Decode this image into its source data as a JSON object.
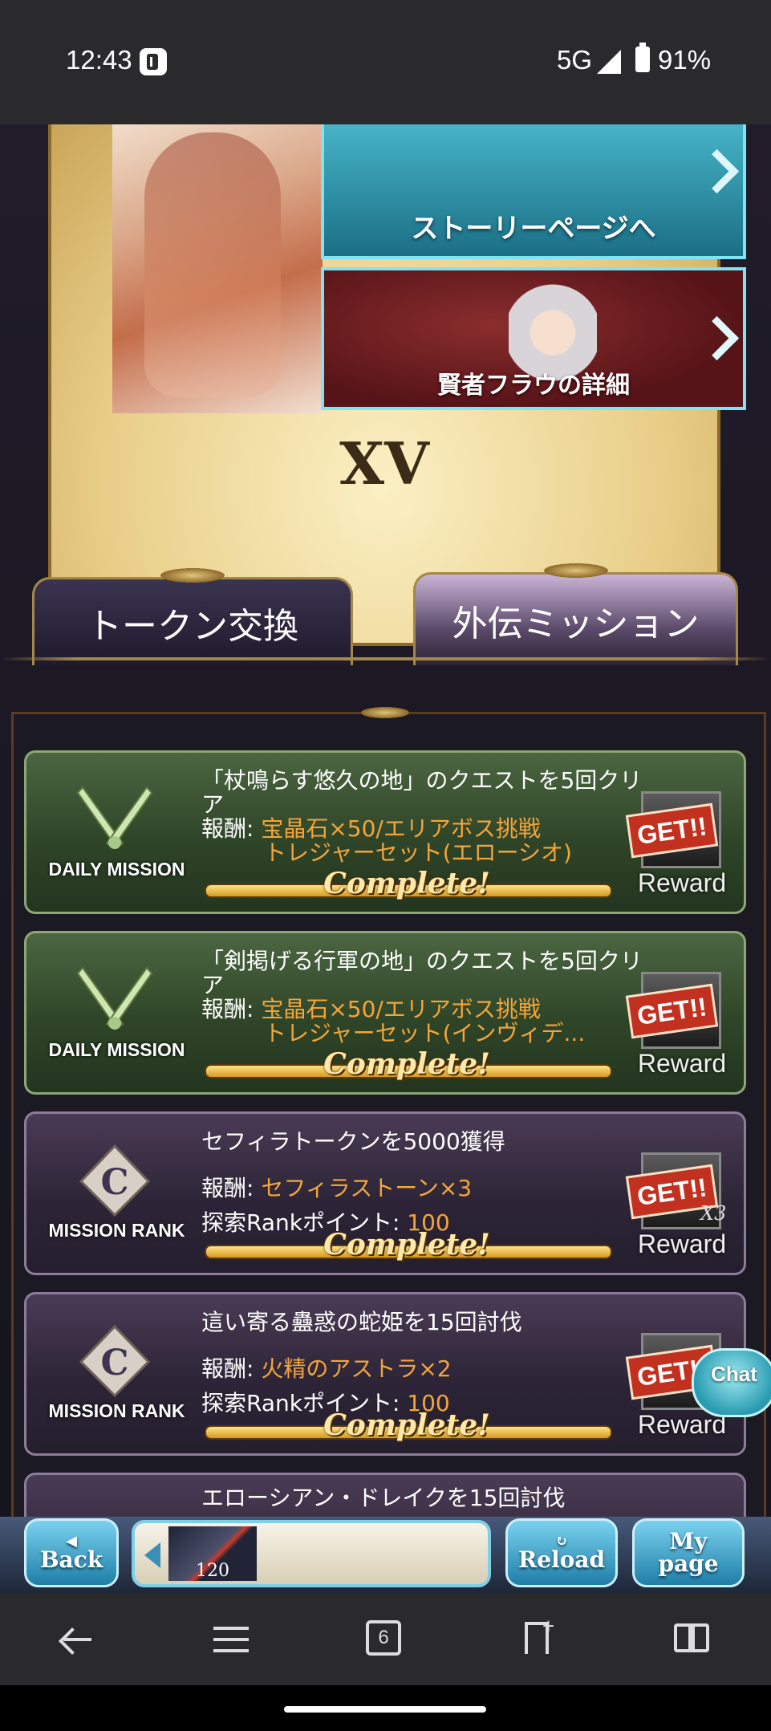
{
  "status_bar": {
    "time": "12:43",
    "network": "5G",
    "battery": "91%"
  },
  "hero": {
    "story_button": "ストーリーページへ",
    "detail_button": "賢者フラウの詳細",
    "chapter_numeral": "XV"
  },
  "tabs": [
    {
      "label": "トークン交換",
      "selected": false
    },
    {
      "label": "外伝ミッション",
      "selected": true
    }
  ],
  "missions": [
    {
      "badge": "DAILY MISSION",
      "title": "「杖鳴らす悠久の地」のクエストを5回クリア",
      "reward_label": "報酬: ",
      "reward_line1": "宝晶石×50/エリアボス挑戦",
      "reward_line2": "トレジャーセット(エローシオ)",
      "status": "Complete!",
      "button_label": "Reward",
      "stamp": "GET!!"
    },
    {
      "badge": "DAILY MISSION",
      "title": "「剣掲げる行軍の地」のクエストを5回クリア",
      "reward_label": "報酬: ",
      "reward_line1": "宝晶石×50/エリアボス挑戦",
      "reward_line2": "トレジャーセット(インヴィデ...",
      "status": "Complete!",
      "button_label": "Reward",
      "stamp": "GET!!"
    },
    {
      "badge": "MISSION RANK",
      "rank_letter": "C",
      "title": "セフィラトークンを5000獲得",
      "reward_label": "報酬: ",
      "reward_line1": "セフィラストーン×3",
      "points_label": "探索Rankポイント: ",
      "points": "100",
      "status": "Complete!",
      "button_label": "Reward",
      "stamp": "GET!!",
      "count": "X3"
    },
    {
      "badge": "MISSION RANK",
      "rank_letter": "C",
      "title": "這い寄る蠱惑の蛇姫を15回討伐",
      "reward_label": "報酬: ",
      "reward_line1": "火精のアストラ×2",
      "points_label": "探索Rankポイント: ",
      "points": "100",
      "status": "Complete!",
      "button_label": "Reward",
      "stamp": "GET!!"
    }
  ],
  "partial_mission_title": "エローシアン・ドレイクを15回討伐",
  "chat_button": "Chat",
  "game_nav": {
    "back": "Back",
    "reload": "Reload",
    "mypage_line1": "My",
    "mypage_line2": "page",
    "slot_count": "120"
  },
  "browser_bar": {
    "tab_count": "6"
  },
  "colors": {
    "reward_text": "#f4a53a",
    "daily_card": "#2f4528",
    "rank_card": "#2d2537",
    "accent_cyan": "#7ee3f2"
  }
}
